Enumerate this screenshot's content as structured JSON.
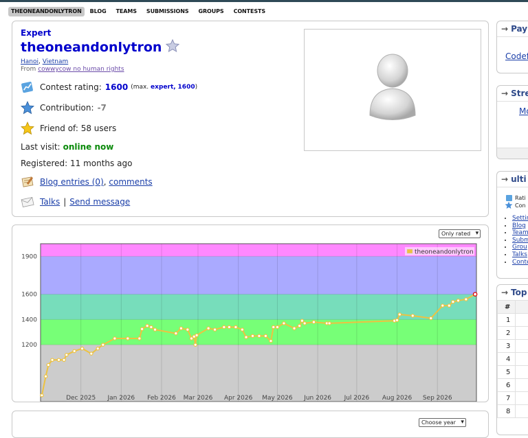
{
  "nav": {
    "items": [
      "THEONEANDONLYTRON",
      "BLOG",
      "TEAMS",
      "SUBMISSIONS",
      "GROUPS",
      "CONTESTS"
    ]
  },
  "profile": {
    "rank": "Expert",
    "handle": "theoneandonlytron",
    "city": "Hanoi",
    "country": "Vietnam",
    "from_prefix": "From",
    "organization": "cowwycow no human rights",
    "contest_rating_label": "Contest rating:",
    "rating": "1600",
    "max_prefix": "(max.",
    "max_rank": "expert,",
    "max_rating": "1600",
    "max_suffix": ")",
    "contribution_label": "Contribution:",
    "contribution": "-7",
    "friend_of": "Friend of: 58 users",
    "last_visit_label": "Last visit:",
    "last_visit": "online now",
    "registered": "Registered: 11 months ago",
    "blog_entries": "Blog entries (0)",
    "comments": "comments",
    "talks": "Talks",
    "send_message": "Send message"
  },
  "chart_controls": {
    "filter": "Only rated"
  },
  "chart_data": {
    "type": "line",
    "title": "",
    "xlabel": "",
    "ylabel": "",
    "legend": "top-right",
    "series": [
      {
        "name": "theoneandonlytron",
        "color": "#edc240",
        "points": [
          [
            "2025-11-01",
            800
          ],
          [
            "2025-11-04",
            950
          ],
          [
            "2025-11-06",
            1040
          ],
          [
            "2025-11-09",
            1080
          ],
          [
            "2025-11-14",
            1080
          ],
          [
            "2025-11-18",
            1080
          ],
          [
            "2025-11-20",
            1120
          ],
          [
            "2025-11-26",
            1150
          ],
          [
            "2025-12-02",
            1170
          ],
          [
            "2025-12-09",
            1130
          ],
          [
            "2025-12-14",
            1170
          ],
          [
            "2025-12-18",
            1200
          ],
          [
            "2025-12-27",
            1250
          ],
          [
            "2026-01-06",
            1250
          ],
          [
            "2026-01-15",
            1250
          ],
          [
            "2026-01-17",
            1325
          ],
          [
            "2026-01-21",
            1350
          ],
          [
            "2026-01-24",
            1340
          ],
          [
            "2026-01-27",
            1320
          ],
          [
            "2026-02-12",
            1290
          ],
          [
            "2026-02-16",
            1330
          ],
          [
            "2026-02-21",
            1320
          ],
          [
            "2026-02-24",
            1250
          ],
          [
            "2026-02-26",
            1265
          ],
          [
            "2026-02-27",
            1200
          ],
          [
            "2026-02-28",
            1275
          ],
          [
            "2026-03-09",
            1330
          ],
          [
            "2026-03-14",
            1320
          ],
          [
            "2026-03-21",
            1340
          ],
          [
            "2026-03-25",
            1340
          ],
          [
            "2026-03-30",
            1340
          ],
          [
            "2026-04-04",
            1320
          ],
          [
            "2026-04-07",
            1260
          ],
          [
            "2026-04-12",
            1270
          ],
          [
            "2026-04-17",
            1270
          ],
          [
            "2026-04-22",
            1270
          ],
          [
            "2026-04-26",
            1230
          ],
          [
            "2026-04-28",
            1340
          ],
          [
            "2026-05-01",
            1340
          ],
          [
            "2026-05-06",
            1370
          ],
          [
            "2026-05-14",
            1330
          ],
          [
            "2026-05-18",
            1350
          ],
          [
            "2026-05-20",
            1390
          ],
          [
            "2026-05-22",
            1370
          ],
          [
            "2026-05-29",
            1380
          ],
          [
            "2026-06-08",
            1370
          ],
          [
            "2026-06-10",
            1370
          ],
          [
            "2026-07-30",
            1390
          ],
          [
            "2026-08-01",
            1395
          ],
          [
            "2026-08-03",
            1440
          ],
          [
            "2026-08-13",
            1430
          ],
          [
            "2026-08-27",
            1410
          ],
          [
            "2026-09-05",
            1510
          ],
          [
            "2026-09-10",
            1510
          ],
          [
            "2026-09-13",
            1540
          ],
          [
            "2026-09-17",
            1550
          ],
          [
            "2026-09-23",
            1560
          ],
          [
            "2026-09-30",
            1600
          ]
        ]
      }
    ],
    "bands": [
      {
        "from": 0,
        "to": 1200,
        "color": "#cccccc"
      },
      {
        "from": 1200,
        "to": 1400,
        "color": "#77ff77"
      },
      {
        "from": 1400,
        "to": 1600,
        "color": "#77ddbb"
      },
      {
        "from": 1600,
        "to": 1900,
        "color": "#aaaaff"
      },
      {
        "from": 1900,
        "to": 2100,
        "color": "#ff88ff"
      }
    ],
    "xlim": [
      "2025-10-31",
      "2026-10-01"
    ],
    "ylim": [
      750,
      2000
    ],
    "y_ticks": [
      1200,
      1400,
      1600,
      1900
    ],
    "x_ticks": [
      {
        "date": "2025-12-01",
        "label": "Dec 2025"
      },
      {
        "date": "2026-01-01",
        "label": "Jan 2026"
      },
      {
        "date": "2026-02-01",
        "label": "Feb 2026"
      },
      {
        "date": "2026-03-01",
        "label": "Mar 2026"
      },
      {
        "date": "2026-04-01",
        "label": "Apr 2026"
      },
      {
        "date": "2026-05-01",
        "label": "May 2026"
      },
      {
        "date": "2026-06-01",
        "label": "Jun 2026"
      },
      {
        "date": "2026-07-01",
        "label": "Jul 2026"
      },
      {
        "date": "2026-08-01",
        "label": "Aug 2026"
      },
      {
        "date": "2026-09-01",
        "label": "Sep 2026"
      }
    ],
    "grid": true
  },
  "activity": {
    "year_select": "Choose year"
  },
  "sidebar": {
    "pay": {
      "title": "Pay",
      "link": "Codefo"
    },
    "streams": {
      "title": "Stre",
      "link": "Mo"
    },
    "user": {
      "title": "ulti",
      "rating_text": "Rati",
      "contrib_text": "Con",
      "links": [
        "Settin",
        "Blog",
        "Team",
        "Subm",
        "Grou",
        "Talks",
        "Conte"
      ]
    },
    "top": {
      "title": "Top",
      "header": "#",
      "rows": [
        "1",
        "2",
        "3",
        "4",
        "5",
        "6",
        "7",
        "8"
      ]
    }
  }
}
